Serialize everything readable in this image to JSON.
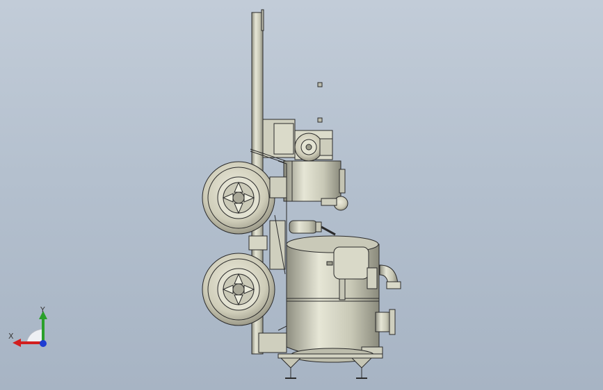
{
  "viewport": {
    "background_top": "#c2ccd8",
    "background_bottom": "#a7b4c4"
  },
  "model": {
    "body_color": "#d4d4c2",
    "edge_color": "#2a2a2a",
    "components": [
      "frame-rail",
      "upper-wheel",
      "lower-wheel",
      "motor-housing",
      "pump-flange",
      "cylinder-actuator",
      "main-tank",
      "elbow-pipe",
      "side-nozzle",
      "leveling-feet"
    ]
  },
  "triad": {
    "x_label": "X",
    "y_label": "Y",
    "x_color": "#d21e1e",
    "y_color": "#2aa02a",
    "z_color": "#1e3cd2"
  }
}
